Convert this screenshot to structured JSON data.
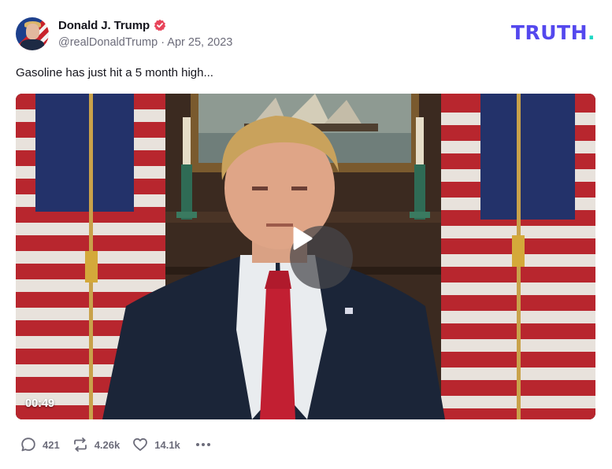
{
  "author": {
    "display_name": "Donald J. Trump",
    "handle": "@realDonaldTrump",
    "separator": "·",
    "date": "Apr 25, 2023",
    "verified_icon": "verified-badge-icon",
    "verified_color": "#e8445a"
  },
  "brand": {
    "logo_text": "TRUTH",
    "logo_dot": ".",
    "logo_color": "#5448ee",
    "dot_color": "#1ed8c4"
  },
  "post": {
    "text": "Gasoline has just hit a 5 month high..."
  },
  "video": {
    "duration": "00:49",
    "play_icon": "play-icon"
  },
  "actions": {
    "replies": {
      "icon": "reply-icon",
      "count": "421"
    },
    "retruths": {
      "icon": "retruth-icon",
      "count": "4.26k"
    },
    "likes": {
      "icon": "heart-icon",
      "count": "14.1k"
    },
    "more": {
      "icon": "more-dots-icon"
    }
  }
}
